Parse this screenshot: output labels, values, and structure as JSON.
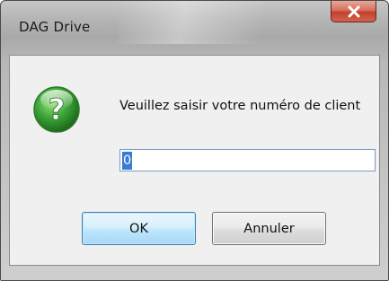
{
  "window": {
    "title": "DAG Drive",
    "close_icon": "close-icon"
  },
  "dialog": {
    "icon": "question-mark-icon",
    "prompt": "Veuillez saisir votre numéro de client",
    "input_value": "0"
  },
  "buttons": {
    "ok_label": "OK",
    "cancel_label": "Annuler"
  },
  "colors": {
    "close_button": "#c7442c",
    "ok_border": "#3c7fb1",
    "selection": "#3a7bd5",
    "icon_green": "#3aa336"
  }
}
